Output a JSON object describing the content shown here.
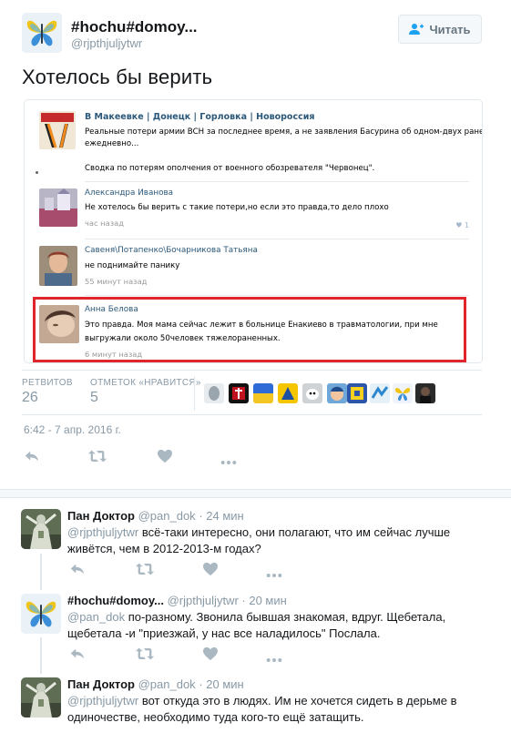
{
  "tweet": {
    "author_name": "#hochu#domoy...",
    "author_handle": "@rjpthjuljytwr",
    "follow_label": "Читать",
    "text": "Хотелось бы верить",
    "timestamp": "6:42 - 7 апр. 2016 г.",
    "retweets_label": "РЕТВИТОВ",
    "retweets_count": "26",
    "likes_label": "ОТМЕТОК «НРАВИТСЯ»",
    "likes_count": "5"
  },
  "media": {
    "group_title": "В Макеевке | Донецк | Горловка | Новороссия",
    "post_line1": "Реальные потери армии ВСН за последнее время, а не заявления Басурина об одном-двух раненных",
    "post_line2": "ежедневно...",
    "post_line3": "Сводка по потерям ополчения от военного обозревателя \"Червонец\".",
    "comments": [
      {
        "name": "Александра Иванова",
        "text": "Не хотелось бы верить с такие потери,но если это правда,то дело плохо",
        "time": "час назад",
        "likes": "1"
      },
      {
        "name": "Савеня\\Потапенко\\Бочарникова Татьяна",
        "text": "не поднимайте панику",
        "time": "55 минут назад"
      },
      {
        "name": "Анна Белова",
        "text_line1": "Это правда. Моя мама сейчас лежит в больнице Енакиево в травматологии, при мне",
        "text_line2": "выгружали около 50человек тяжелораненных.",
        "time": "6 минут назад"
      }
    ]
  },
  "replies": [
    {
      "name": "Пан Доктор",
      "handle": "@pan_dok",
      "time": "· 24 мин",
      "mention": "@rjpthjuljytwr",
      "text": " всё-таки интересно, они полагают, что им сейчас лучше живётся, чем в 2012-2013-м годах?"
    },
    {
      "name": "#hochu#domoy...",
      "handle": "@rjpthjuljytwr",
      "time": "· 20 мин",
      "mention": "@pan_dok",
      "text": " по-разному. Звонила бывшая знакомая, вдруг. Щебетала, щебетала -и \"приезжай, у нас все наладилось\" Послала."
    },
    {
      "name": "Пан Доктор",
      "handle": "@pan_dok",
      "time": "· 20 мин",
      "mention": "@rjpthjuljytwr",
      "text": " вот откуда это в людях. Им не хочется сидеть в дерьме в одиночестве, необходимо туда кого-то ещё затащить."
    }
  ],
  "colors": {
    "accent": "#1da1f2",
    "muted": "#8899a6",
    "vk_link": "#2b587a",
    "highlight": "#e0262c"
  },
  "icons": [
    "follow-person-icon",
    "reply-icon",
    "retweet-icon",
    "like-icon",
    "more-icon"
  ]
}
